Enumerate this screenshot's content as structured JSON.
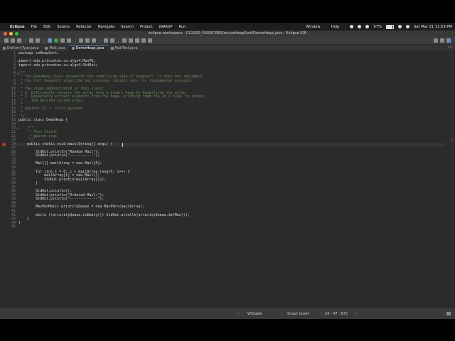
{
  "menubar": {
    "apple": "",
    "items": [
      "Eclipse",
      "File",
      "Edit",
      "Source",
      "Refactor",
      "Navigate",
      "Search",
      "Project",
      "jGRASP",
      "Run"
    ],
    "window": "Window",
    "help": "Help",
    "battery": "97%",
    "datetime": "Sat Mar 21  11:53 PM"
  },
  "window": {
    "title": "eclipse-workspace - CS2420_EXERCISES/src/ceHeapSort/DemoHeap.java - Eclipse IDE"
  },
  "tabs": [
    {
      "label": "DeliveryType.java",
      "active": false
    },
    {
      "label": "Mail.java",
      "active": false
    },
    {
      "label": "DemoHeap.java",
      "active": true
    },
    {
      "label": "MailTest.java",
      "active": false
    }
  ],
  "tab_overflow": "»1",
  "editor": {
    "current_line": 24,
    "lines": [
      {
        "n": "1",
        "text": "package ceHeapSort;"
      },
      {
        "n": "2",
        "text": ""
      },
      {
        "n": "3",
        "text": "import edu.princeton.cs.algs4.MaxPQ;",
        "fold": "⊖"
      },
      {
        "n": "4",
        "text": "import edu.princeton.cs.algs4.StdOut;"
      },
      {
        "n": "5",
        "text": ""
      },
      {
        "n": "6",
        "text": "/**",
        "fold": "⊖"
      },
      {
        "n": "7",
        "text": " * The DemoHeap class documents the underlying idea of heapsort. It does not implement"
      },
      {
        "n": "8",
        "text": " * the full heapsort algorithm but provides insight into its fundamental concepts."
      },
      {
        "n": "9",
        "text": " * "
      },
      {
        "n": "10",
        "text": " * The steps demonstrated in this class:"
      },
      {
        "n": "11",
        "text": " * 1. Efficiently convert the array into a binary heap by heapifying the array"
      },
      {
        "n": "12",
        "text": " * 2. Repeatedly extract elements from the heap, printing them one at a time, to obtain"
      },
      {
        "n": "13",
        "text": " *    the desired sorted order."
      },
      {
        "n": "14",
        "text": " * "
      },
      {
        "n": "15",
        "text": " * @author CS -- colin.kwiatek"
      },
      {
        "n": "16",
        "text": " * "
      },
      {
        "n": "17",
        "text": " */"
      },
      {
        "n": "18",
        "text": "public class DemoHeap {"
      },
      {
        "n": "19",
        "text": ""
      },
      {
        "n": "20",
        "text": "    /**",
        "fold": "⊖"
      },
      {
        "n": "21",
        "text": "     * Test Client"
      },
      {
        "n": "22",
        "text": "     * @param args"
      },
      {
        "n": "23",
        "text": "     */"
      },
      {
        "n": "24",
        "text": "    public static void main(String[] args) {",
        "fold": "⊖"
      },
      {
        "n": "25",
        "text": ""
      },
      {
        "n": "26",
        "text": "        StdOut.println(\"Random Mail\");"
      },
      {
        "n": "27",
        "text": "        StdOut.println(\"-----------\");"
      },
      {
        "n": "28",
        "text": ""
      },
      {
        "n": "29",
        "text": "        Mail[] mailArray = new Mail[5];"
      },
      {
        "n": "30",
        "text": ""
      },
      {
        "n": "31",
        "text": "        for (int i = 0; i < mailArray.length; i++) {"
      },
      {
        "n": "32",
        "text": "            mailArray[i] = new Mail();"
      },
      {
        "n": "33",
        "text": "            StdOut.println(mailArray[i]);"
      },
      {
        "n": "34",
        "text": "        }"
      },
      {
        "n": "35",
        "text": ""
      },
      {
        "n": "36",
        "text": "        StdOut.println();"
      },
      {
        "n": "37",
        "text": "        StdOut.println(\"Ordered Mail:\");"
      },
      {
        "n": "38",
        "text": "        StdOut.println(\"-------------\");"
      },
      {
        "n": "39",
        "text": ""
      },
      {
        "n": "40",
        "text": "        MaxPQ<Mail> priorityQueue = new MaxPQ<>(mailArray);"
      },
      {
        "n": "41",
        "text": ""
      },
      {
        "n": "42",
        "text": "        while (!priorityQueue.isEmpty()) StdOut.println(priorityQueue.delMax());"
      },
      {
        "n": "43",
        "text": "    }"
      },
      {
        "n": "44",
        "text": "}"
      },
      {
        "n": "45",
        "text": ""
      }
    ]
  },
  "status": {
    "writable": "Writable",
    "insert_mode": "Smart Insert",
    "position": "24 : 47 : 672"
  }
}
